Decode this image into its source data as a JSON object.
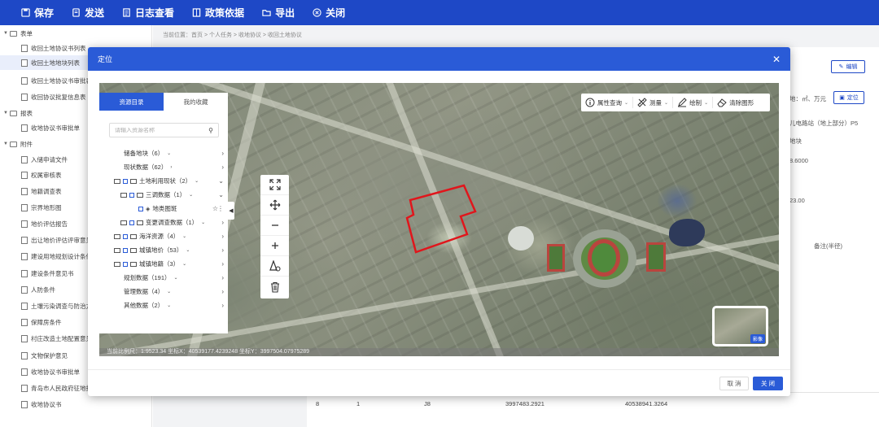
{
  "toolbar": {
    "buttons": [
      {
        "label": "保存",
        "icon": "save-icon"
      },
      {
        "label": "发送",
        "icon": "send-icon"
      },
      {
        "label": "日志查看",
        "icon": "log-icon"
      },
      {
        "label": "政策依据",
        "icon": "policy-icon"
      },
      {
        "label": "导出",
        "icon": "export-folder-icon"
      },
      {
        "label": "关闭",
        "icon": "close-circle-icon"
      }
    ]
  },
  "sidebar": {
    "items": [
      {
        "label": "表单",
        "type": "folder"
      },
      {
        "label": "收回土地协议书列表",
        "type": "doc"
      },
      {
        "label": "收回土地地块列表",
        "type": "doc",
        "selected": true
      },
      {
        "label": "收回土地协议书审批表",
        "type": "doc"
      },
      {
        "label": "收回协议批复信息表",
        "type": "doc"
      },
      {
        "label": "报表",
        "type": "folder"
      },
      {
        "label": "收地协议书审批单",
        "type": "doc"
      },
      {
        "label": "附件",
        "type": "folder"
      },
      {
        "label": "入储申请文件",
        "type": "doc"
      },
      {
        "label": "权属审核表",
        "type": "doc"
      },
      {
        "label": "地籍调查表",
        "type": "doc"
      },
      {
        "label": "宗界地形图",
        "type": "doc"
      },
      {
        "label": "地价评估报告",
        "type": "doc"
      },
      {
        "label": "出让地价评估评审意见",
        "type": "doc"
      },
      {
        "label": "建设用地规划设计条件",
        "type": "doc"
      },
      {
        "label": "建设条件意见书",
        "type": "doc"
      },
      {
        "label": "人防条件",
        "type": "doc"
      },
      {
        "label": "土壤污染调查与防治方案",
        "type": "doc"
      },
      {
        "label": "保障房条件",
        "type": "doc"
      },
      {
        "label": "村庄改造土地配置意见",
        "type": "doc"
      },
      {
        "label": "文物保护意见",
        "type": "doc"
      },
      {
        "label": "收地协议书审批单",
        "type": "doc"
      },
      {
        "label": "青岛市人民政府征地批复",
        "type": "doc"
      },
      {
        "label": "收地协议书",
        "type": "doc"
      }
    ]
  },
  "background": {
    "breadcrumb": "当前位置：首页 > 个人任务 > 收地协议 > 收回土地协议",
    "edit_label": "编辑",
    "locate_label": "定位",
    "unit_text": "地：㎡、万元",
    "texts": [
      "儿电路站（地上部分）P5",
      "地块",
      "8.6000",
      "23.00",
      "备注(半径)"
    ],
    "table_row": [
      "8",
      "1",
      "J8",
      "3997483.2921",
      "40538941.3264"
    ]
  },
  "modal": {
    "title": "定位",
    "cancel_label": "取 消",
    "close_label": "关 闭"
  },
  "map": {
    "tabs": [
      "资源目录",
      "我的收藏"
    ],
    "search_placeholder": "请输入资源名称",
    "tree": [
      {
        "label": "储备地块（6）",
        "level": 0,
        "checkbox": false,
        "folder": false
      },
      {
        "label": "现状数据（62）",
        "level": 0,
        "checkbox": false,
        "folder": false
      },
      {
        "label": "土地利用现状（2）",
        "level": 0,
        "checkbox": true,
        "folder": true
      },
      {
        "label": "三调数据（1）",
        "level": 1,
        "checkbox": true,
        "folder": true
      },
      {
        "label": "地类图斑",
        "level": 2,
        "checkbox": true,
        "folder": false,
        "layer": true
      },
      {
        "label": "变更调查数据（1）",
        "level": 1,
        "checkbox": true,
        "folder": true
      },
      {
        "label": "海洋资源（4）",
        "level": 0,
        "checkbox": true,
        "folder": true
      },
      {
        "label": "城镇地价（53）",
        "level": 0,
        "checkbox": true,
        "folder": true
      },
      {
        "label": "城镇地籍（3）",
        "level": 0,
        "checkbox": true,
        "folder": true
      },
      {
        "label": "规划数据（191）",
        "level": 0,
        "checkbox": false,
        "folder": false
      },
      {
        "label": "管理数据（4）",
        "level": 0,
        "checkbox": false,
        "folder": false
      },
      {
        "label": "其他数据（2）",
        "level": 0,
        "checkbox": false,
        "folder": false
      }
    ],
    "tools": [
      "fullscreen-icon",
      "pan-icon",
      "zoom-out-icon",
      "zoom-in-icon",
      "measure-area-icon",
      "delete-icon"
    ],
    "top_tools": [
      {
        "label": "属性查询",
        "icon": "info-icon"
      },
      {
        "label": "测量",
        "icon": "ruler-icon"
      },
      {
        "label": "绘制",
        "icon": "pencil-icon"
      },
      {
        "label": "清除图形",
        "icon": "eraser-icon"
      }
    ],
    "status_text": "当前比例尺：1:9523.34    坐标X：40539177.4239248    坐标Y：3997504.07975289",
    "basemap_label": "影像",
    "highlight_color": "#e0161c"
  }
}
